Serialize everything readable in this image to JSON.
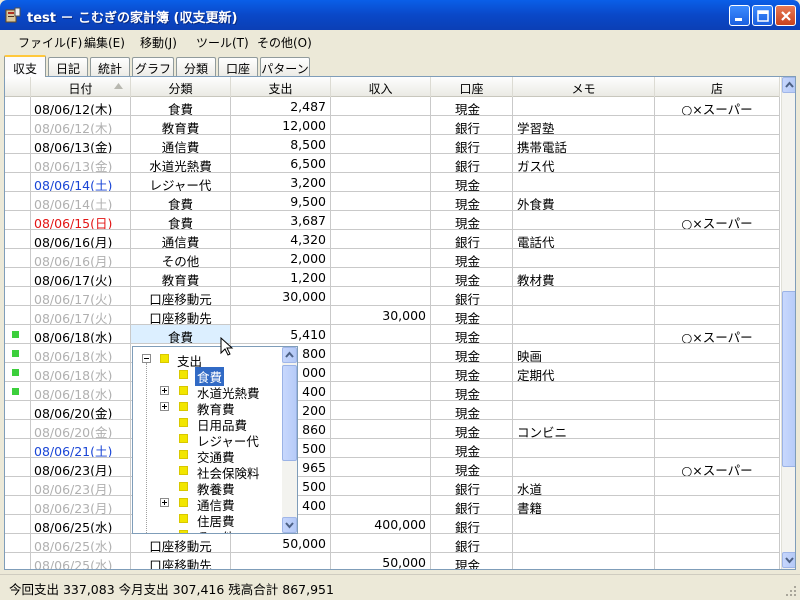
{
  "window": {
    "title": "test － こむぎの家計簿 (収支更新)"
  },
  "menu": [
    "ファイル(F)",
    "編集(E)",
    "移動(J)",
    "ツール(T)",
    "その他(O)"
  ],
  "tabs": [
    "収支",
    "日記",
    "統計",
    "グラフ",
    "分類",
    "口座",
    "パターン"
  ],
  "columns": {
    "date": "日付",
    "category": "分類",
    "expense": "支出",
    "income": "収入",
    "account": "口座",
    "memo": "メモ",
    "store": "店"
  },
  "rows": [
    {
      "date": "08/06/12(木)",
      "category": "食費",
      "expense": "2,487",
      "income": "",
      "account": "現金",
      "memo": "",
      "store": "○×スーパー",
      "style": "normal",
      "mark": false
    },
    {
      "date": "08/06/12(木)",
      "category": "教育費",
      "expense": "12,000",
      "income": "",
      "account": "銀行",
      "memo": "学習塾",
      "store": "",
      "style": "gray",
      "mark": false
    },
    {
      "date": "08/06/13(金)",
      "category": "通信費",
      "expense": "8,500",
      "income": "",
      "account": "銀行",
      "memo": "携帯電話",
      "store": "",
      "style": "normal",
      "mark": false
    },
    {
      "date": "08/06/13(金)",
      "category": "水道光熱費",
      "expense": "6,500",
      "income": "",
      "account": "銀行",
      "memo": "ガス代",
      "store": "",
      "style": "gray",
      "mark": false
    },
    {
      "date": "08/06/14(土)",
      "category": "レジャー代",
      "expense": "3,200",
      "income": "",
      "account": "現金",
      "memo": "",
      "store": "",
      "style": "blue",
      "mark": false
    },
    {
      "date": "08/06/14(土)",
      "category": "食費",
      "expense": "9,500",
      "income": "",
      "account": "現金",
      "memo": "外食費",
      "store": "",
      "style": "gray",
      "mark": false
    },
    {
      "date": "08/06/15(日)",
      "category": "食費",
      "expense": "3,687",
      "income": "",
      "account": "現金",
      "memo": "",
      "store": "○×スーパー",
      "style": "red",
      "mark": false
    },
    {
      "date": "08/06/16(月)",
      "category": "通信費",
      "expense": "4,320",
      "income": "",
      "account": "銀行",
      "memo": "電話代",
      "store": "",
      "style": "normal",
      "mark": false
    },
    {
      "date": "08/06/16(月)",
      "category": "その他",
      "expense": "2,000",
      "income": "",
      "account": "現金",
      "memo": "",
      "store": "",
      "style": "gray",
      "mark": false
    },
    {
      "date": "08/06/17(火)",
      "category": "教育費",
      "expense": "1,200",
      "income": "",
      "account": "現金",
      "memo": "教材費",
      "store": "",
      "style": "normal",
      "mark": false
    },
    {
      "date": "08/06/17(火)",
      "category": "口座移動元",
      "expense": "30,000",
      "income": "",
      "account": "銀行",
      "memo": "",
      "store": "",
      "style": "gray",
      "mark": false
    },
    {
      "date": "08/06/17(火)",
      "category": "口座移動先",
      "expense": "",
      "income": "30,000",
      "account": "現金",
      "memo": "",
      "store": "",
      "style": "gray",
      "mark": false
    },
    {
      "date": "08/06/18(水)",
      "category": "食費",
      "expense": "5,410",
      "income": "",
      "account": "現金",
      "memo": "",
      "store": "○×スーパー",
      "style": "normal",
      "mark": true
    },
    {
      "date": "08/06/18(水)",
      "category": "",
      "expense": "800",
      "income": "",
      "account": "現金",
      "memo": "映画",
      "store": "",
      "style": "gray",
      "mark": true
    },
    {
      "date": "08/06/18(水)",
      "category": "",
      "expense": "000",
      "income": "",
      "account": "現金",
      "memo": "定期代",
      "store": "",
      "style": "gray",
      "mark": true
    },
    {
      "date": "08/06/18(水)",
      "category": "",
      "expense": "400",
      "income": "",
      "account": "現金",
      "memo": "",
      "store": "",
      "style": "gray",
      "mark": true
    },
    {
      "date": "08/06/20(金)",
      "category": "",
      "expense": "200",
      "income": "",
      "account": "現金",
      "memo": "",
      "store": "",
      "style": "normal",
      "mark": false
    },
    {
      "date": "08/06/20(金)",
      "category": "",
      "expense": "860",
      "income": "",
      "account": "現金",
      "memo": "コンビニ",
      "store": "",
      "style": "gray",
      "mark": false
    },
    {
      "date": "08/06/21(土)",
      "category": "",
      "expense": "500",
      "income": "",
      "account": "現金",
      "memo": "",
      "store": "",
      "style": "blue",
      "mark": false
    },
    {
      "date": "08/06/23(月)",
      "category": "",
      "expense": "965",
      "income": "",
      "account": "現金",
      "memo": "",
      "store": "○×スーパー",
      "style": "normal",
      "mark": false
    },
    {
      "date": "08/06/23(月)",
      "category": "",
      "expense": "500",
      "income": "",
      "account": "銀行",
      "memo": "水道",
      "store": "",
      "style": "gray",
      "mark": false
    },
    {
      "date": "08/06/23(月)",
      "category": "",
      "expense": "400",
      "income": "",
      "account": "銀行",
      "memo": "書籍",
      "store": "",
      "style": "gray",
      "mark": false
    },
    {
      "date": "08/06/25(水)",
      "category": "",
      "expense": "",
      "income": "400,000",
      "account": "銀行",
      "memo": "",
      "store": "",
      "style": "normal",
      "mark": false
    },
    {
      "date": "08/06/25(水)",
      "category": "口座移動元",
      "expense": "50,000",
      "income": "",
      "account": "銀行",
      "memo": "",
      "store": "",
      "style": "gray",
      "mark": false
    },
    {
      "date": "08/06/25(水)",
      "category": "口座移動先",
      "expense": "",
      "income": "50,000",
      "account": "現金",
      "memo": "",
      "store": "",
      "style": "gray",
      "mark": false
    }
  ],
  "dropdown": {
    "root": "支出",
    "items": [
      {
        "label": "食費",
        "expandable": false,
        "selected": true
      },
      {
        "label": "水道光熱費",
        "expandable": true,
        "selected": false
      },
      {
        "label": "教育費",
        "expandable": true,
        "selected": false
      },
      {
        "label": "日用品費",
        "expandable": false,
        "selected": false
      },
      {
        "label": "レジャー代",
        "expandable": false,
        "selected": false
      },
      {
        "label": "交通費",
        "expandable": false,
        "selected": false
      },
      {
        "label": "社会保険料",
        "expandable": false,
        "selected": false
      },
      {
        "label": "教養費",
        "expandable": false,
        "selected": false
      },
      {
        "label": "通信費",
        "expandable": true,
        "selected": false
      },
      {
        "label": "住居費",
        "expandable": false,
        "selected": false
      },
      {
        "label": "その他",
        "expandable": false,
        "selected": false
      }
    ]
  },
  "status": {
    "text": "今回支出 337,083  今月支出 307,416  残高合計 867,951"
  },
  "colors": {
    "title_bar": "#0a5fe8",
    "selection": "#316ac5",
    "holiday": "#e21414",
    "saturday": "#1a46d6",
    "inactive": "#b0b0b0",
    "mark": "#3ccf3c",
    "category_square": "#f2e600"
  }
}
